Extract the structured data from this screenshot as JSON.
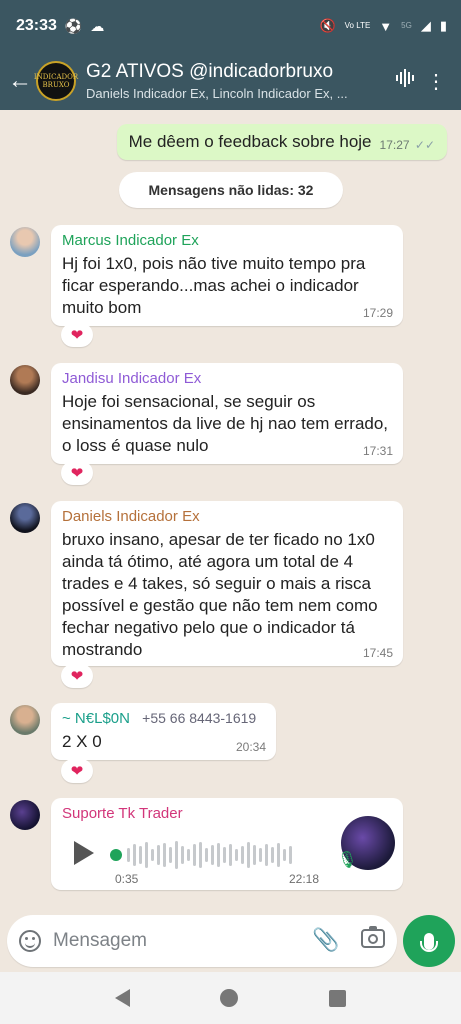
{
  "status_bar": {
    "time": "23:33",
    "left_icons": [
      "soccer-ball-icon",
      "cloud-icon"
    ],
    "right_icons": [
      "mute-icon",
      "volte-icon",
      "wifi-icon",
      "5g-icon",
      "signal-icon",
      "battery-icon"
    ],
    "volte_label": "Vo LTE",
    "network_label": "5G"
  },
  "header": {
    "title": "G2 ATIVOS @indicadorbruxo",
    "subtitle": "Daniels Indicador Ex, Lincoln Indicador Ex, ...",
    "avatar_text": "INDICADOR BRUXO"
  },
  "outgoing": {
    "text": "Me dêem o feedback sobre hoje",
    "time": "17:27",
    "status": "✓✓"
  },
  "unread_banner": "Mensagens não lidas: 32",
  "messages": [
    {
      "sender": "Marcus Indicador Ex",
      "sender_color": "#1fa35a",
      "text": "Hj foi 1x0, pois não tive muito tempo pra ficar esperando...mas achei o indicador muito bom",
      "time": "17:29",
      "reaction": "❤"
    },
    {
      "sender": "Jandisu Indicador Ex",
      "sender_color": "#8f5bd6",
      "text": "Hoje foi sensacional, se seguir os ensinamentos da live de hj nao tem errado, o loss é quase nulo",
      "time": "17:31",
      "reaction": "❤"
    },
    {
      "sender": "Daniels Indicador Ex",
      "sender_color": "#b5713b",
      "text": "bruxo insano, apesar de ter ficado no 1x0 ainda tá ótimo, até agora um total de 4 trades e 4 takes, só seguir o mais a risca possível e gestão que não tem nem como fechar negativo pelo que o indicador tá mostrando",
      "time": "17:45",
      "reaction": "❤"
    },
    {
      "sender": "~ N€L$0N",
      "sender_color": "#1a9f8a",
      "phone": "+55 66 8443-1619",
      "text": "2 X 0",
      "time": "20:34",
      "reaction": "❤"
    }
  ],
  "voice_message": {
    "sender": "Suporte Tk Trader",
    "sender_color": "#d2367a",
    "duration": "0:35",
    "time": "22:18"
  },
  "input": {
    "placeholder": "Mensagem"
  },
  "colors": {
    "header_bg": "#3b5661",
    "chat_bg": "#efe7de",
    "outgoing_bubble": "#dcf8c6",
    "accent_green": "#1fa35a",
    "reaction_heart": "#e0245e"
  }
}
